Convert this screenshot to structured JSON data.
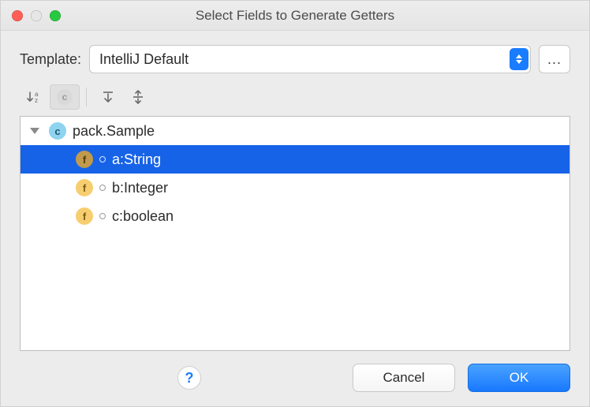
{
  "window": {
    "title": "Select Fields to Generate Getters"
  },
  "template": {
    "label": "Template:",
    "selected": "IntelliJ Default",
    "moreLabel": "..."
  },
  "toolbar": {
    "sort": "sort-alpha",
    "showClasses": "c-badge",
    "expand": "expand-all",
    "collapse": "collapse-all"
  },
  "tree": {
    "root": {
      "label": "pack.Sample",
      "icon": "c"
    },
    "fields": [
      {
        "label": "a:String",
        "icon": "f",
        "selected": true
      },
      {
        "label": "b:Integer",
        "icon": "f",
        "selected": false
      },
      {
        "label": "c:boolean",
        "icon": "f",
        "selected": false
      }
    ]
  },
  "footer": {
    "help": "?",
    "cancel": "Cancel",
    "ok": "OK"
  }
}
